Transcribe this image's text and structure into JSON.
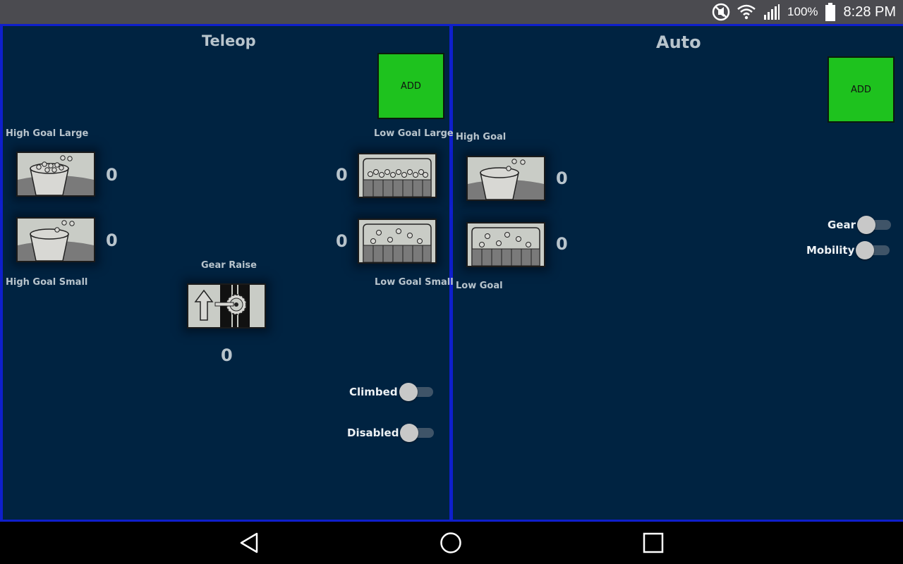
{
  "status_bar": {
    "icons": [
      "mute-icon",
      "wifi-icon",
      "signal-icon",
      "battery-icon"
    ],
    "battery_text": "100%",
    "time": "8:28 PM"
  },
  "teleop": {
    "title": "Teleop",
    "add_label": "ADD",
    "high_goal_large": {
      "label": "High Goal Large",
      "count": "0"
    },
    "high_goal_small": {
      "label": "High Goal Small",
      "count": "0"
    },
    "low_goal_large": {
      "label": "Low Goal Large",
      "count": "0"
    },
    "low_goal_small": {
      "label": "Low Goal Small",
      "count": "0"
    },
    "gear_raise": {
      "label": "Gear Raise",
      "count": "0"
    },
    "climbed": {
      "label": "Climbed",
      "on": false
    },
    "disabled": {
      "label": "Disabled",
      "on": false
    }
  },
  "auto": {
    "title": "Auto",
    "add_label": "ADD",
    "high_goal": {
      "label": "High Goal",
      "count": "0"
    },
    "low_goal": {
      "label": "Low Goal",
      "count": "0"
    },
    "gear": {
      "label": "Gear",
      "on": false
    },
    "mobility": {
      "label": "Mobility",
      "on": false
    }
  },
  "nav": {
    "icons": [
      "back-icon",
      "home-icon",
      "recents-icon"
    ]
  },
  "colors": {
    "panel_bg": "#002341",
    "divider": "#0f1fcc",
    "add_button": "#1ec21e",
    "label": "#b8c4cc"
  }
}
